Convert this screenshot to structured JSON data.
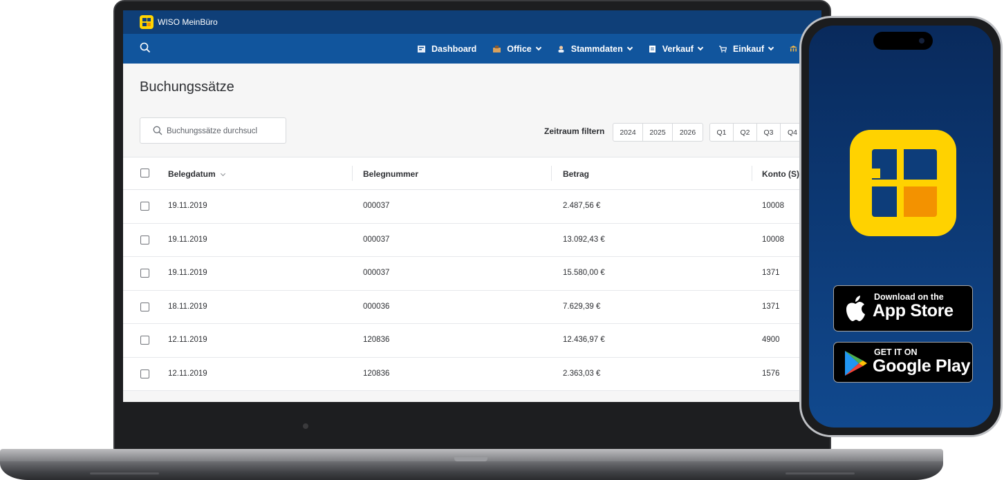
{
  "app": {
    "name": "WISO MeinBüro",
    "brand_color": "#0f3f78",
    "accent_color": "#ffd400"
  },
  "nav": {
    "items": [
      {
        "label": "Dashboard",
        "icon": "dashboard-icon"
      },
      {
        "label": "Office",
        "icon": "office-icon"
      },
      {
        "label": "Stammdaten",
        "icon": "person-icon"
      },
      {
        "label": "Verkauf",
        "icon": "document-icon"
      },
      {
        "label": "Einkauf",
        "icon": "cart-icon"
      }
    ]
  },
  "page": {
    "title": "Buchungssätze",
    "search_value": "Buchungssätze durchsucl"
  },
  "filter": {
    "label": "Zeitraum filtern",
    "years": [
      "2024",
      "2025",
      "2026"
    ],
    "quarters": [
      "Q1",
      "Q2",
      "Q3",
      "Q4"
    ]
  },
  "table": {
    "columns": [
      "Belegdatum",
      "Belegnummer",
      "Betrag",
      "Konto (S)"
    ],
    "rows": [
      {
        "date": "19.11.2019",
        "number": "000037",
        "amount": "2.487,56 €",
        "account": "10008"
      },
      {
        "date": "19.11.2019",
        "number": "000037",
        "amount": "13.092,43 €",
        "account": "10008"
      },
      {
        "date": "19.11.2019",
        "number": "000037",
        "amount": "15.580,00 €",
        "account": "1371"
      },
      {
        "date": "18.11.2019",
        "number": "000036",
        "amount": "7.629,39 €",
        "account": "1371"
      },
      {
        "date": "12.11.2019",
        "number": "120836",
        "amount": "12.436,97 €",
        "account": "4900"
      },
      {
        "date": "12.11.2019",
        "number": "120836",
        "amount": "2.363,03 €",
        "account": "1576"
      }
    ]
  },
  "phone": {
    "app_store": {
      "small": "Download on the",
      "big": "App Store"
    },
    "google_play": {
      "small": "GET IT ON",
      "big": "Google Play"
    }
  }
}
